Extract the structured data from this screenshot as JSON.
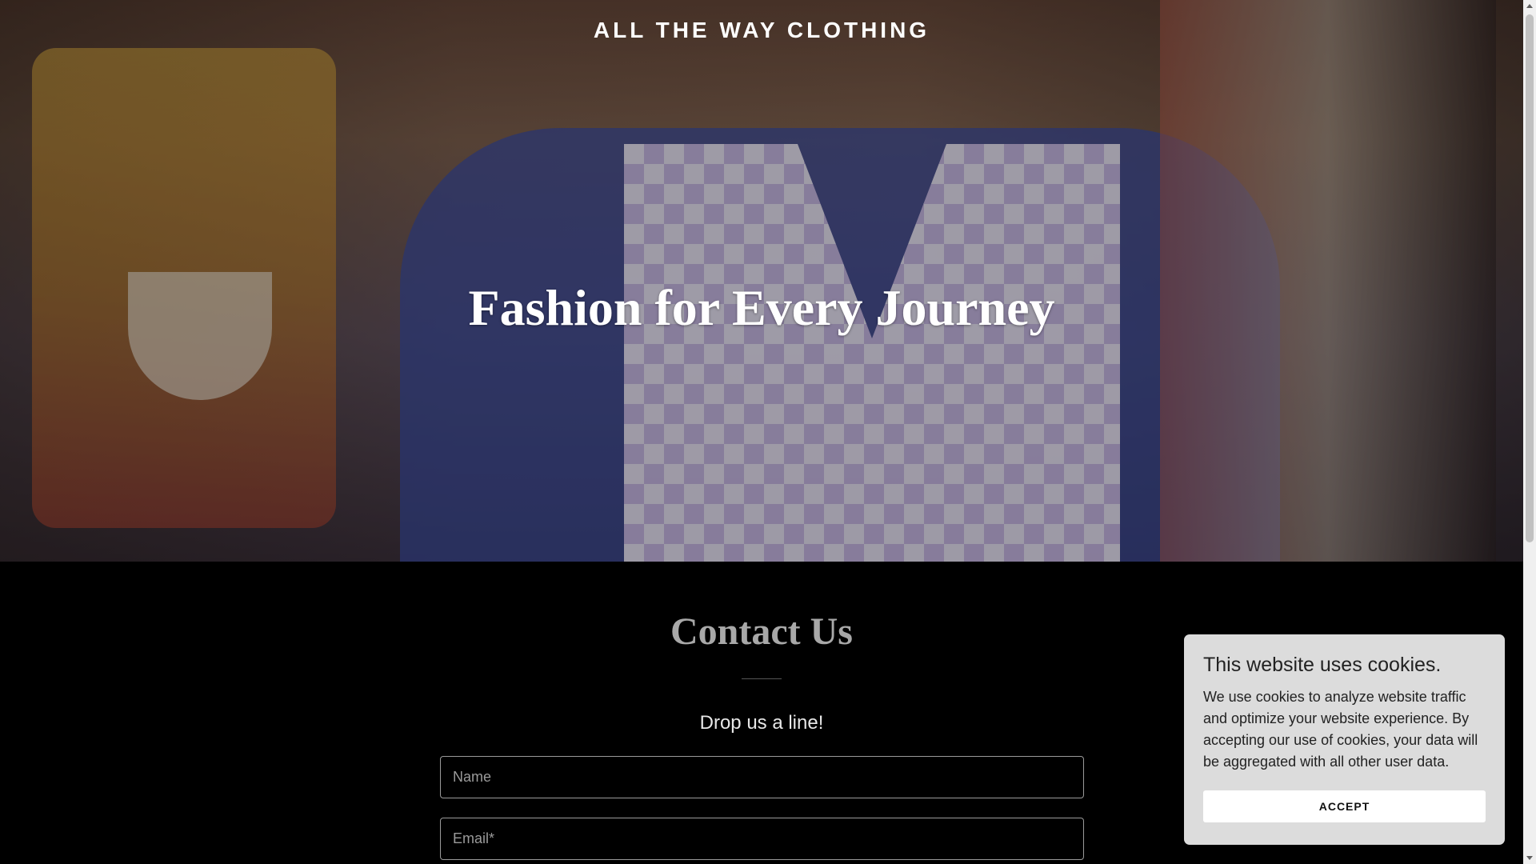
{
  "header": {
    "site_title": "ALL THE WAY CLOTHING"
  },
  "hero": {
    "tagline": "Fashion for Every Journey"
  },
  "contact": {
    "heading": "Contact Us",
    "subheading": "Drop us a line!",
    "name_placeholder": "Name",
    "email_placeholder": "Email*"
  },
  "cookie_banner": {
    "title": "This website uses cookies.",
    "body": "We use cookies to analyze website traffic and optimize your website experience. By accepting our use of cookies, your data will be aggregated with all other user data.",
    "accept_label": "ACCEPT"
  },
  "colors": {
    "page_background": "#000000",
    "cookie_background": "#dcdcdc",
    "heading_gray": "#a8a8a8"
  }
}
